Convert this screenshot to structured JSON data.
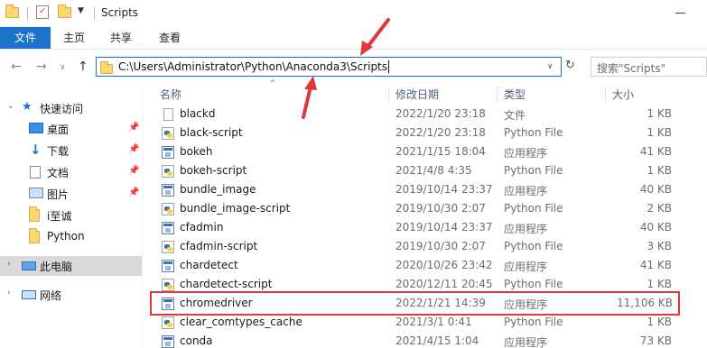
{
  "window": {
    "title": "Scripts"
  },
  "ribbon": {
    "tabs": [
      "文件",
      "主页",
      "共享",
      "查看"
    ]
  },
  "address": {
    "path": "C:\\Users\\Administrator\\Python\\Anaconda3\\Scripts",
    "search_placeholder": "搜索\"Scripts\""
  },
  "sidebar": {
    "quick_access": "快速访问",
    "items": [
      {
        "label": "桌面",
        "icon": "desktop-icon",
        "pinned": true
      },
      {
        "label": "下载",
        "icon": "download-icon",
        "pinned": true
      },
      {
        "label": "文档",
        "icon": "document-icon",
        "pinned": true
      },
      {
        "label": "图片",
        "icon": "picture-icon",
        "pinned": true
      },
      {
        "label": "i至诚",
        "icon": "folder-icon",
        "pinned": false
      },
      {
        "label": "Python",
        "icon": "folder-icon",
        "pinned": false
      }
    ],
    "this_pc": "此电脑",
    "network": "网络"
  },
  "columns": {
    "name": "名称",
    "date": "修改日期",
    "type": "类型",
    "size": "大小"
  },
  "files": [
    {
      "name": "blackd",
      "date": "2022/1/20 23:18",
      "type": "文件",
      "size": "1 KB",
      "icon": "blank"
    },
    {
      "name": "black-script",
      "date": "2022/1/20 23:18",
      "type": "Python File",
      "size": "1 KB",
      "icon": "py"
    },
    {
      "name": "bokeh",
      "date": "2021/1/15 18:04",
      "type": "应用程序",
      "size": "41 KB",
      "icon": "exe"
    },
    {
      "name": "bokeh-script",
      "date": "2021/4/8 4:35",
      "type": "Python File",
      "size": "1 KB",
      "icon": "py"
    },
    {
      "name": "bundle_image",
      "date": "2019/10/14 23:37",
      "type": "应用程序",
      "size": "40 KB",
      "icon": "exe"
    },
    {
      "name": "bundle_image-script",
      "date": "2019/10/30 2:07",
      "type": "Python File",
      "size": "2 KB",
      "icon": "py"
    },
    {
      "name": "cfadmin",
      "date": "2019/10/14 23:37",
      "type": "应用程序",
      "size": "40 KB",
      "icon": "exe"
    },
    {
      "name": "cfadmin-script",
      "date": "2019/10/30 2:07",
      "type": "Python File",
      "size": "3 KB",
      "icon": "py"
    },
    {
      "name": "chardetect",
      "date": "2020/10/26 23:42",
      "type": "应用程序",
      "size": "41 KB",
      "icon": "exe"
    },
    {
      "name": "chardetect-script",
      "date": "2020/12/11 20:45",
      "type": "Python File",
      "size": "1 KB",
      "icon": "py"
    },
    {
      "name": "chromedriver",
      "date": "2022/1/21 14:39",
      "type": "应用程序",
      "size": "11,106 KB",
      "icon": "exe",
      "highlight": true
    },
    {
      "name": "clear_comtypes_cache",
      "date": "2021/3/1 0:41",
      "type": "Python File",
      "size": "1 KB",
      "icon": "py"
    },
    {
      "name": "conda",
      "date": "2021/4/15 1:04",
      "type": "应用程序",
      "size": "73 KB",
      "icon": "exe"
    }
  ],
  "colors": {
    "accent": "#1a73c9",
    "highlight_border": "#e03838",
    "arrow": "#e03838"
  }
}
